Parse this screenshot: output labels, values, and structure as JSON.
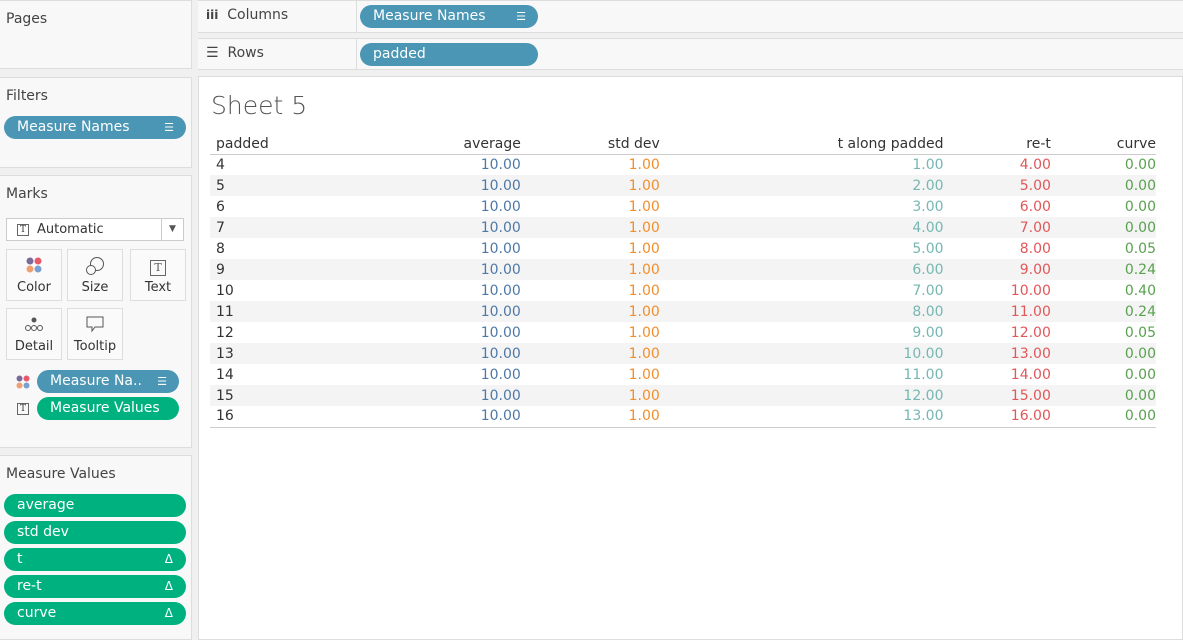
{
  "pages": {
    "title": "Pages"
  },
  "filters": {
    "title": "Filters",
    "pills": [
      "Measure Names"
    ]
  },
  "marks": {
    "title": "Marks",
    "type": "Automatic",
    "buttons": [
      "Color",
      "Size",
      "Text",
      "Detail",
      "Tooltip"
    ],
    "pills": [
      "Measure Na..",
      "Measure Values"
    ]
  },
  "measure_values": {
    "title": "Measure Values",
    "pills": [
      "average",
      "std dev",
      "t",
      "re-t",
      "curve"
    ]
  },
  "columns": {
    "label": "Columns",
    "pill": "Measure Names"
  },
  "rows": {
    "label": "Rows",
    "pill": "padded"
  },
  "sheet": {
    "title": "Sheet 5"
  },
  "table": {
    "headers": [
      "padded",
      "average",
      "std dev",
      "t along padded",
      "re-t",
      "curve"
    ],
    "colors": [
      "#333333",
      "#4e79a7",
      "#f28e2b",
      "#76b7b2",
      "#e15759",
      "#59a14f"
    ],
    "rows": [
      [
        "4",
        "10.00",
        "1.00",
        "1.00",
        "4.00",
        "0.00"
      ],
      [
        "5",
        "10.00",
        "1.00",
        "2.00",
        "5.00",
        "0.00"
      ],
      [
        "6",
        "10.00",
        "1.00",
        "3.00",
        "6.00",
        "0.00"
      ],
      [
        "7",
        "10.00",
        "1.00",
        "4.00",
        "7.00",
        "0.00"
      ],
      [
        "8",
        "10.00",
        "1.00",
        "5.00",
        "8.00",
        "0.05"
      ],
      [
        "9",
        "10.00",
        "1.00",
        "6.00",
        "9.00",
        "0.24"
      ],
      [
        "10",
        "10.00",
        "1.00",
        "7.00",
        "10.00",
        "0.40"
      ],
      [
        "11",
        "10.00",
        "1.00",
        "8.00",
        "11.00",
        "0.24"
      ],
      [
        "12",
        "10.00",
        "1.00",
        "9.00",
        "12.00",
        "0.05"
      ],
      [
        "13",
        "10.00",
        "1.00",
        "10.00",
        "13.00",
        "0.00"
      ],
      [
        "14",
        "10.00",
        "1.00",
        "11.00",
        "14.00",
        "0.00"
      ],
      [
        "15",
        "10.00",
        "1.00",
        "12.00",
        "15.00",
        "0.00"
      ],
      [
        "16",
        "10.00",
        "1.00",
        "13.00",
        "16.00",
        "0.00"
      ]
    ]
  }
}
